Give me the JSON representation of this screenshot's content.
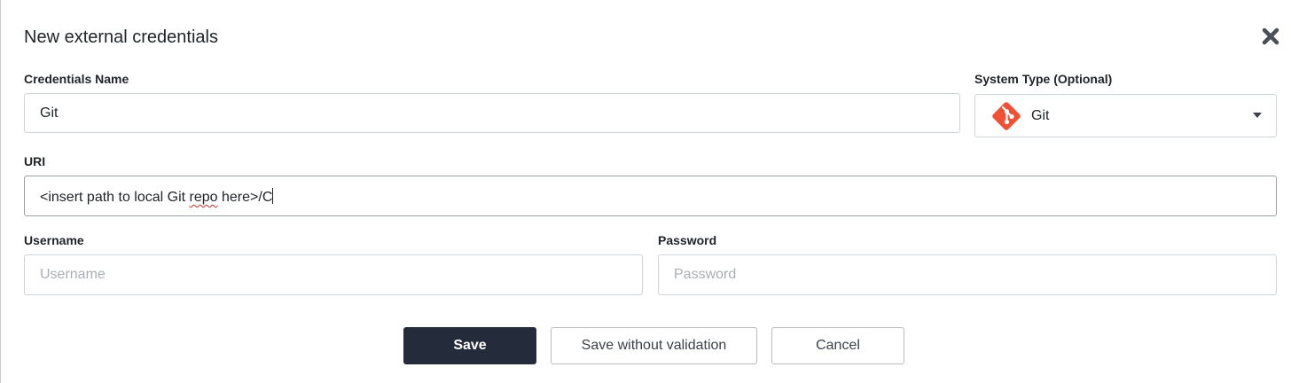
{
  "dialog": {
    "title": "New external credentials"
  },
  "form": {
    "credentials_name": {
      "label": "Credentials Name",
      "value": "Git"
    },
    "system_type": {
      "label": "System Type (Optional)",
      "selected": "Git",
      "icon": "git-logo-icon"
    },
    "uri": {
      "label": "URI",
      "value_prefix": "<insert path to local Git ",
      "value_misspelled": "repo",
      "value_suffix": " here>/C"
    },
    "username": {
      "label": "Username",
      "value": "",
      "placeholder": "Username"
    },
    "password": {
      "label": "Password",
      "value": "",
      "placeholder": "Password"
    }
  },
  "actions": {
    "save_label": "Save",
    "save_without_validation_label": "Save without validation",
    "cancel_label": "Cancel"
  },
  "colors": {
    "primary_button": "#242b3a",
    "git_brand": "#f05033",
    "text": "#212529",
    "border": "#ced4da"
  }
}
